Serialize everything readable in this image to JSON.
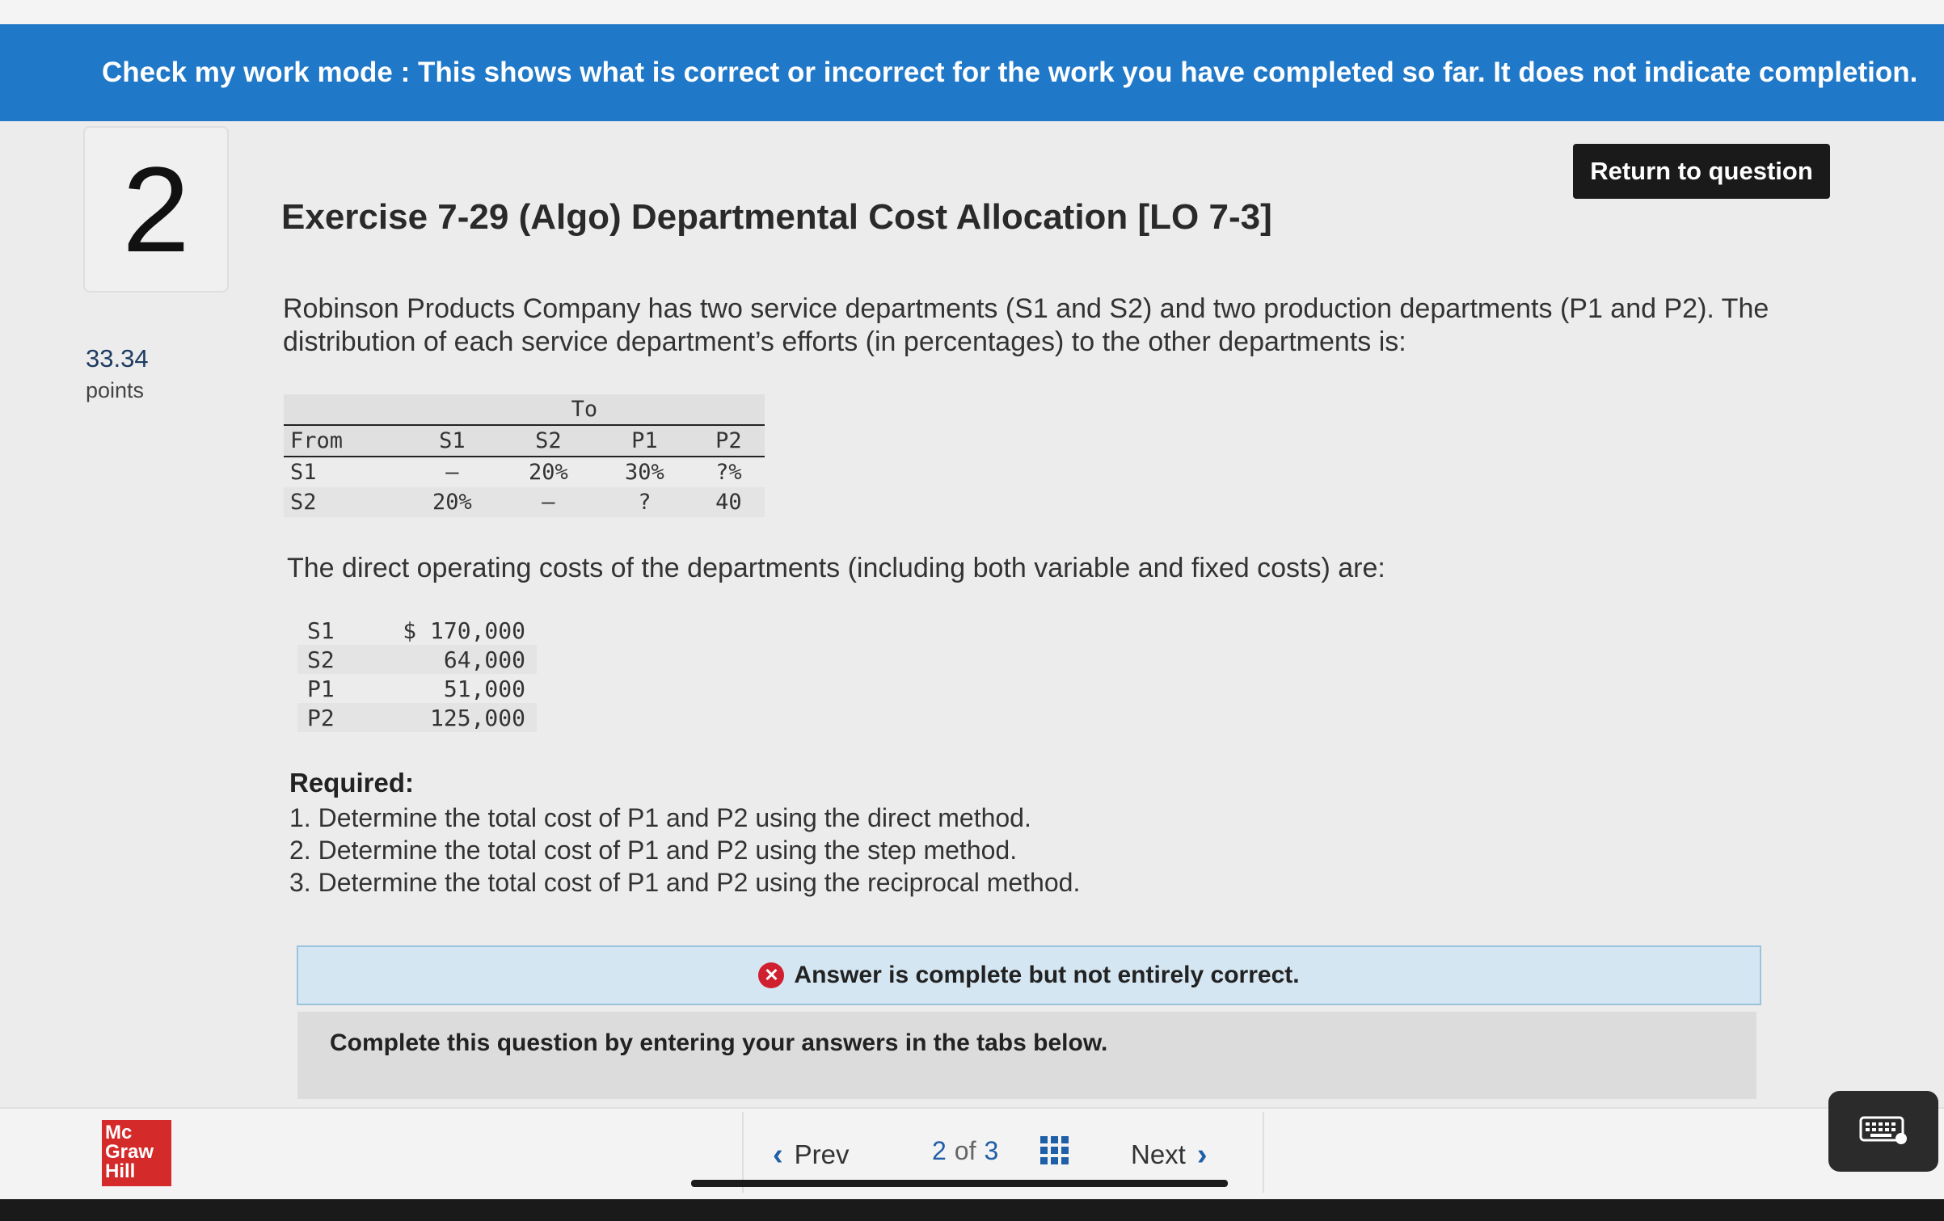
{
  "banner": {
    "text": "Check my work mode : This shows what is correct or incorrect for the work you have completed so far. It does not indicate completion."
  },
  "question": {
    "number": "2",
    "points_value": "33.34",
    "points_label": "points",
    "return_button": "Return to question",
    "title": "Exercise 7-29 (Algo) Departmental Cost Allocation [LO 7-3]",
    "intro": "Robinson Products Company has two service departments (S1 and S2) and two production departments (P1 and P2). The distribution of each service department’s efforts (in percentages) to the other departments is:"
  },
  "distribution_table": {
    "to_header": "To",
    "from_header": "From",
    "columns": [
      "S1",
      "S2",
      "P1",
      "P2"
    ],
    "rows": [
      {
        "label": "S1",
        "cells": [
          "–",
          "20%",
          "30%",
          "?%"
        ]
      },
      {
        "label": "S2",
        "cells": [
          "20%",
          "–",
          "?",
          "40"
        ]
      }
    ]
  },
  "costs": {
    "intro": "The direct operating costs of the departments (including both variable and fixed costs) are:",
    "rows": [
      {
        "dept": "S1",
        "amount": "$ 170,000"
      },
      {
        "dept": "S2",
        "amount": "64,000"
      },
      {
        "dept": "P1",
        "amount": "51,000"
      },
      {
        "dept": "P2",
        "amount": "125,000"
      }
    ]
  },
  "required": {
    "heading": "Required:",
    "items": [
      "1. Determine the total cost of P1 and P2 using the direct method.",
      "2. Determine the total cost of P1 and P2 using the step method.",
      "3. Determine the total cost of P1 and P2 using the reciprocal method."
    ]
  },
  "feedback": {
    "status_text": "Answer is complete but not entirely correct.",
    "status_color": "#d01f2e",
    "tabs_note": "Complete this question by entering your answers in the tabs below."
  },
  "footer": {
    "logo_lines": [
      "Mc",
      "Graw",
      "Hill"
    ],
    "prev_label": "Prev",
    "next_label": "Next",
    "current_page": "2",
    "of_label": "of",
    "total_pages": "3"
  },
  "icons": {
    "error": "x-circle-icon",
    "prev": "chevron-left-icon",
    "next": "chevron-right-icon",
    "grid": "grid-icon",
    "keyboard": "keyboard-icon"
  },
  "colors": {
    "banner": "#1f78c8",
    "accent": "#1f5fa8",
    "logo": "#d42a2a"
  }
}
